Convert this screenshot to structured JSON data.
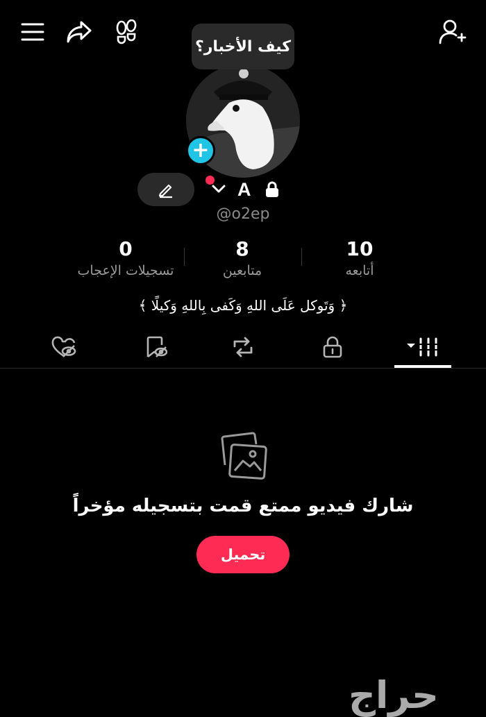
{
  "colors": {
    "accent": "#fe2c55",
    "story_add": "#20c5e6",
    "background": "#000000"
  },
  "top_bar": {
    "icons": [
      "menu-icon",
      "share-icon",
      "footprints-icon",
      "add-friend-icon"
    ]
  },
  "note_bubble": {
    "text": "كيف الأخبار؟"
  },
  "profile": {
    "name": "A",
    "handle": "@o2ep",
    "edit_icon": "pencil-icon",
    "lock_icon": "lock-icon"
  },
  "stats": [
    {
      "value": "10",
      "label": "أتابعه"
    },
    {
      "value": "8",
      "label": "متابعين"
    },
    {
      "value": "0",
      "label": "تسجيلات الإعجاب"
    }
  ],
  "bio": "﴿ وَتَوكل عَلَى اللهِ وَكَفى بِاللهِ وَكيلًا ﴾",
  "tabs": [
    {
      "icon": "videos-grid-icon",
      "active": true
    },
    {
      "icon": "private-lock-icon",
      "active": false
    },
    {
      "icon": "repost-icon",
      "active": false
    },
    {
      "icon": "favorites-icon",
      "active": false
    },
    {
      "icon": "liked-icon",
      "active": false
    }
  ],
  "empty_state": {
    "icon": "photos-icon",
    "title": "شارك فيديو ممتع قمت بتسجيله مؤخراً",
    "button": "تحميل"
  },
  "watermark": "حراج"
}
